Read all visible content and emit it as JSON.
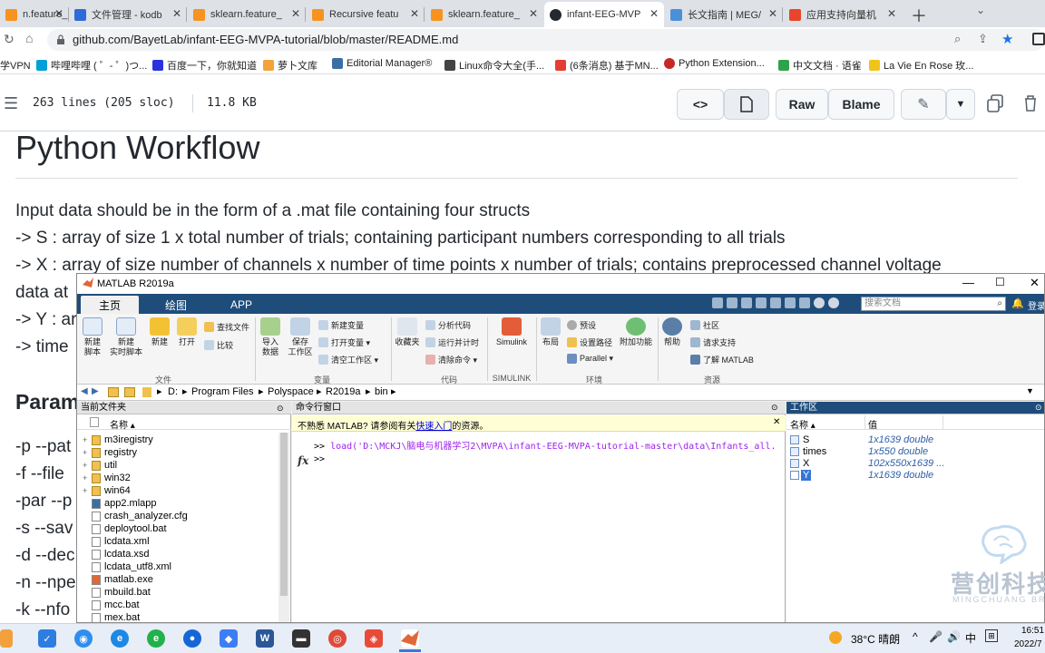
{
  "browser": {
    "tabs": [
      {
        "label": "n.feature_",
        "color": "#f7931e"
      },
      {
        "label": "文件管理 - kodb",
        "color": "#2d6bd9"
      },
      {
        "label": "sklearn.feature_",
        "color": "#f7931e"
      },
      {
        "label": "Recursive featu",
        "color": "#f7931e"
      },
      {
        "label": "sklearn.feature_",
        "color": "#f7931e"
      },
      {
        "label": "infant-EEG-MVP",
        "color": "#24292f"
      },
      {
        "label": "长文指南 | MEG/",
        "color": "#4a90d9"
      },
      {
        "label": "应用支持向量机",
        "color": "#e8452c"
      }
    ],
    "url": "github.com/BayetLab/infant-EEG-MVPA-tutorial/blob/master/README.md",
    "bookmarks": [
      {
        "label": "学VPN",
        "color": "#2d8cf0"
      },
      {
        "label": "哔哩哔哩 ( ゜- ゜)つ...",
        "color": "#00a1d6"
      },
      {
        "label": "百度一下，你就知道",
        "color": "#2932e1"
      },
      {
        "label": "萝卜文库",
        "color": "#f2a33a"
      },
      {
        "label": "Editorial Manager®",
        "color": "#3b6ea5"
      },
      {
        "label": "Linux命令大全(手...",
        "color": "#444444"
      },
      {
        "label": "(6条消息) 基于MN...",
        "color": "#e33e33"
      },
      {
        "label": "Python Extension...",
        "color": "#c62828"
      },
      {
        "label": "中文文档 · 语雀",
        "color": "#2fa34b"
      },
      {
        "label": "La Vie En Rose 玫...",
        "color": "#f0c419"
      }
    ]
  },
  "github": {
    "file_info": "263 lines (205 sloc)",
    "file_size": "11.8 KB",
    "raw_label": "Raw",
    "blame_label": "Blame"
  },
  "readme": {
    "heading": "Python Workflow",
    "line1": "Input data should be in the form of a .mat file containing four structs",
    "line2": "-> S : array of size 1 x total number of trials; containing participant numbers corresponding to all trials",
    "line3": "-> X : array of size number of channels x number of time points x number of trials; contains preprocessed channel voltage",
    "line4": "data at",
    "line5": "-> Y : ar",
    "line6": "-> time",
    "heading2": "Param",
    "params": [
      "-p --pat",
      "-f --file",
      "-par --p",
      "-s --sav",
      "-d --dec",
      "-n --npe",
      "-k --nfo"
    ]
  },
  "matlab": {
    "title": "MATLAB R2019a",
    "tabs": [
      "主页",
      "绘图",
      "APP"
    ],
    "search_placeholder": "搜索文档",
    "login": "登录",
    "ribbon": {
      "new_script": "新建\n脚本",
      "new_live": "新建\n实时脚本",
      "new": "新建",
      "open": "打开",
      "find_files": "查找文件",
      "compare": "比较",
      "import": "导入\n数据",
      "save_ws": "保存\n工作区",
      "new_var": "新建变量",
      "open_var": "打开变量 ▾",
      "clear_ws": "清空工作区 ▾",
      "favorites": "收藏夹",
      "analyze": "分析代码",
      "run_time": "运行并计时",
      "clear_cmd": "清除命令 ▾",
      "simulink": "Simulink",
      "layout": "布局",
      "prefs": "预设",
      "set_path": "设置路径",
      "parallel": "Parallel ▾",
      "addons": "附加功能",
      "help": "帮助",
      "community": "社区",
      "support": "请求支持",
      "learn": "了解 MATLAB",
      "groups": [
        "文件",
        "变量",
        "代码",
        "SIMULINK",
        "环境",
        "资源"
      ]
    },
    "path": [
      "D:",
      "Program Files",
      "Polyspace",
      "R2019a",
      "bin"
    ],
    "current_folder": {
      "title": "当前文件夹",
      "col_name": "名称 ▴",
      "items": [
        {
          "name": "m3iregistry",
          "type": "folder"
        },
        {
          "name": "registry",
          "type": "folder"
        },
        {
          "name": "util",
          "type": "folder"
        },
        {
          "name": "win32",
          "type": "folder"
        },
        {
          "name": "win64",
          "type": "folder"
        },
        {
          "name": "app2.mlapp",
          "type": "app"
        },
        {
          "name": "crash_analyzer.cfg",
          "type": "file"
        },
        {
          "name": "deploytool.bat",
          "type": "file"
        },
        {
          "name": "lcdata.xml",
          "type": "xml"
        },
        {
          "name": "lcdata.xsd",
          "type": "xml"
        },
        {
          "name": "lcdata_utf8.xml",
          "type": "xml"
        },
        {
          "name": "matlab.exe",
          "type": "exe"
        },
        {
          "name": "mbuild.bat",
          "type": "file"
        },
        {
          "name": "mcc.bat",
          "type": "file"
        },
        {
          "name": "mex.bat",
          "type": "file"
        }
      ]
    },
    "command_window": {
      "title": "命令行窗口",
      "notice_prefix": "不熟悉 MATLAB? 请参阅有关",
      "notice_link": "快速入门",
      "notice_suffix": "的资源。",
      "prompt": ">>",
      "command": "load('D:\\MCKJ\\脑电与机器学习2\\MVPA\\infant-EEG-MVPA-tutorial-master\\data\\Infants_all.",
      "fx": "fx"
    },
    "workspace": {
      "title": "工作区",
      "col_name": "名称 ▴",
      "col_value": "值",
      "vars": [
        {
          "name": "S",
          "value": "1x1639 double"
        },
        {
          "name": "times",
          "value": "1x550 double"
        },
        {
          "name": "X",
          "value": "102x550x1639 ..."
        },
        {
          "name": "Y",
          "value": "1x1639 double"
        }
      ]
    }
  },
  "watermark": {
    "cn": "营创科技",
    "en": "MINGCHUANG BRA"
  },
  "taskbar": {
    "weather": "38°C 晴朗",
    "ime": "中",
    "time": "16:51",
    "date": "2022/7"
  }
}
